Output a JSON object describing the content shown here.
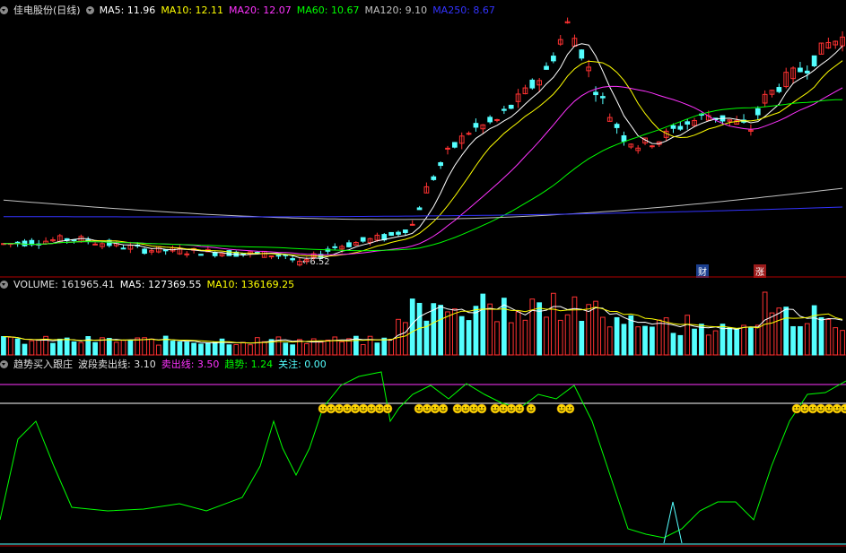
{
  "price_header": {
    "title": "佳电股份(日线)",
    "ma5": "MA5: 11.96",
    "ma10": "MA10: 12.11",
    "ma20": "MA20: 12.07",
    "ma60": "MA60: 10.67",
    "ma120": "MA120: 9.10",
    "ma250": "MA250: 8.67"
  },
  "volume_header": {
    "volume": "VOLUME: 161965.41",
    "ma5": "MA5: 127369.55",
    "ma10": "MA10: 136169.25"
  },
  "indicator_header": {
    "name": "趋势买入跟庄",
    "wave_sell": "波段卖出线: 3.10",
    "sell_line": "卖出线: 3.50",
    "trend": "趋势: 1.24",
    "focus": "关注: 0.00"
  },
  "price_annotations": {
    "low_price_label": "6.52",
    "tag_finance": "财",
    "tag_rise": "涨"
  },
  "colors": {
    "up": "#ff3232",
    "down": "#54ffff",
    "ma5": "#ffffff",
    "ma10": "#ffff00",
    "ma20": "#ff33ff",
    "ma60": "#00ff00",
    "ma120": "#c0c0c0",
    "ma250": "#3333ff",
    "panel_border": "#b00000",
    "smiley": "#ffd700"
  },
  "chart_data": [
    {
      "type": "candlestick",
      "title": "佳电股份(日线)",
      "series_names": [
        "MA5",
        "MA10",
        "MA20",
        "MA60",
        "MA120",
        "MA250"
      ],
      "latest_ma_values": [
        11.96,
        12.11,
        12.07,
        10.67,
        9.1,
        8.67
      ],
      "min_price_marked": 6.52
    },
    {
      "type": "bar",
      "title": "VOLUME",
      "latest": 161965.41,
      "ma5": 127369.55,
      "ma10": 136169.25
    },
    {
      "type": "line",
      "title": "趋势买入跟庄",
      "series_names": [
        "波段卖出线",
        "卖出线",
        "趋势",
        "关注"
      ],
      "latest_values": [
        3.1,
        3.5,
        1.24,
        0.0
      ]
    }
  ]
}
